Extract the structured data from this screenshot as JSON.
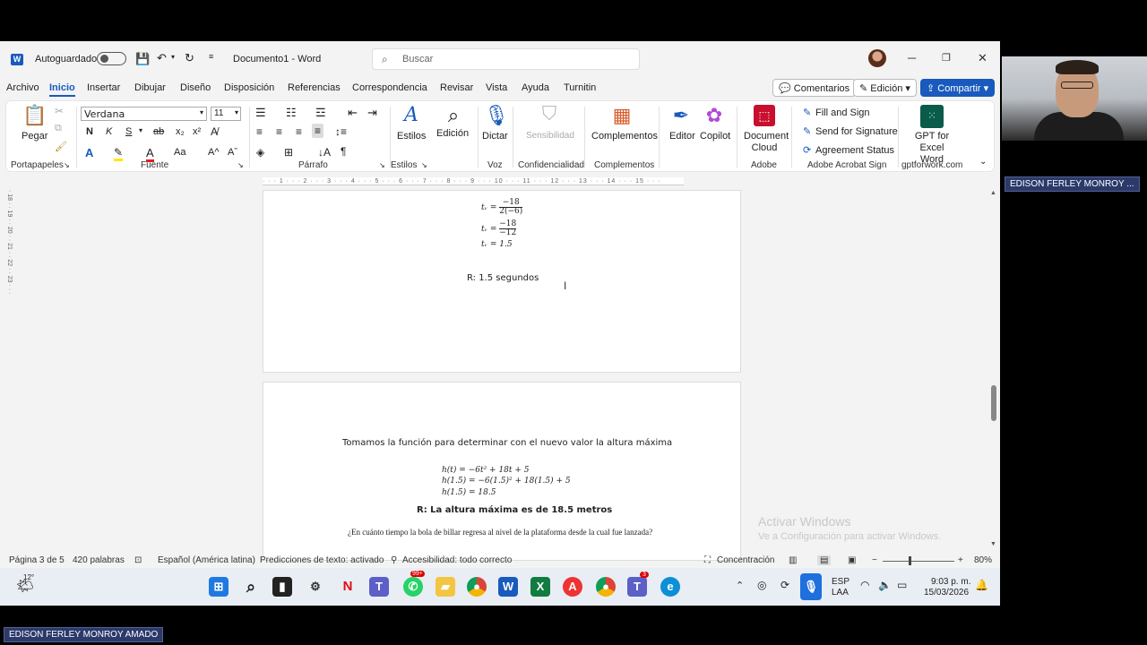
{
  "titlebar": {
    "autosave_label": "Autoguardado",
    "doc_title": "Documento1 - Word",
    "search_placeholder": "Buscar"
  },
  "menu": {
    "items": [
      "Archivo",
      "Inicio",
      "Insertar",
      "Dibujar",
      "Diseño",
      "Disposición",
      "Referencias",
      "Correspondencia",
      "Revisar",
      "Vista",
      "Ayuda",
      "Turnitin"
    ],
    "comments": "Comentarios",
    "edit_mode": "Edición",
    "share": "Compartir"
  },
  "ribbon": {
    "paste": "Pegar",
    "font_name": "Verdana",
    "font_size": "11",
    "styles": "Estilos",
    "editing": "Edición",
    "dictate": "Dictar",
    "sensitivity": "Sensibilidad",
    "addins": "Complementos",
    "editor": "Editor",
    "copilot": "Copilot",
    "document_cloud": "Document Cloud",
    "fill_sign": "Fill and Sign",
    "send_signature": "Send for Signature",
    "agreement_status": "Agreement Status",
    "gpt": "GPT for Excel Word",
    "groups": {
      "clipboard": "Portapapeles",
      "font": "Fuente",
      "paragraph": "Párrafo",
      "styles": "Estilos",
      "voice": "Voz",
      "confidentiality": "Confidencialidad",
      "addins": "Complementos",
      "adobe": "Adobe",
      "adobe_sign": "Adobe Acrobat Sign",
      "gptforwork": "gptforwork.com"
    }
  },
  "document": {
    "page1": {
      "eq1_lhs": "tᵥ =",
      "eq1_num": "−18",
      "eq1_den": "2(−6)",
      "eq2_lhs": "tᵥ =",
      "eq2_num": "−18",
      "eq2_den": "−12",
      "eq3": "tᵥ = 1.5",
      "answer": "R: 1.5 segundos"
    },
    "page2": {
      "intro": "Tomamos la función para determinar con el nuevo valor la altura máxima",
      "h1": "h(t) = −6t² + 18t + 5",
      "h2": "h(1.5) = −6(1.5)² + 18(1.5) + 5",
      "h3": "h(1.5) = 18.5",
      "answer": "R: La altura máxima es de 18.5 metros",
      "question": "¿En cuánto tiempo la bola de billar regresa al nivel de la plataforma desde la cual fue lanzada?"
    }
  },
  "watermark": {
    "line1": "Activar Windows",
    "line2": "Ve a Configuración para activar Windows."
  },
  "statusbar": {
    "page": "Página 3 de 5",
    "words": "420 palabras",
    "language": "Español (América latina)",
    "predictions": "Predicciones de texto: activado",
    "accessibility": "Accesibilidad: todo correcto",
    "focus": "Concentración",
    "zoom": "80%"
  },
  "taskbar": {
    "weather": "12°",
    "whatsapp_badge": "99+",
    "teams_badge": "3",
    "lang_line1": "ESP",
    "lang_line2": "LAA",
    "time": "9:03 p. m.",
    "date": "15/03/2026"
  },
  "video": {
    "participant_top": "EDISON FERLEY MONROY ...",
    "participant_bottom": "EDISON FERLEY MONROY AMADO"
  },
  "colors": {
    "word_blue": "#185abd",
    "ribbon_bg": "#ffffff",
    "chrome_bg": "#f3f3f3",
    "name_tag_bg": "#2b3a6b"
  }
}
